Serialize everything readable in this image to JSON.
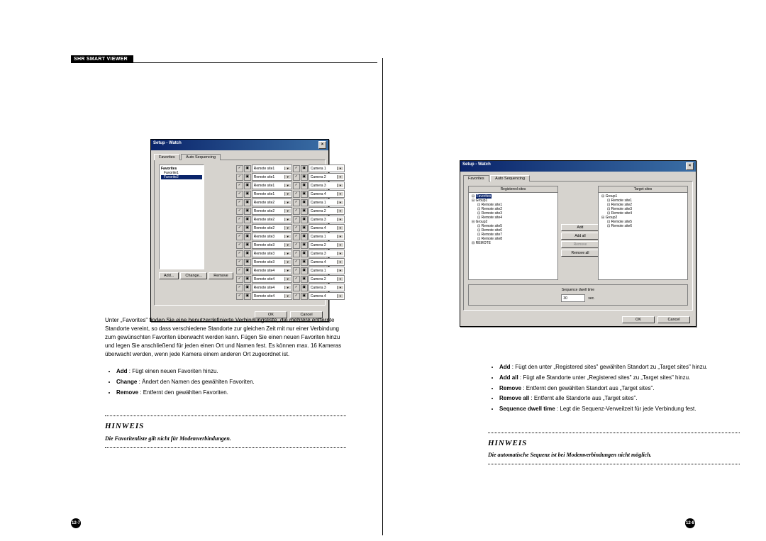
{
  "header": "SHR SMART VIEWER",
  "pageLeft": "12-7",
  "pageRight": "12-8",
  "win1": {
    "title": "Setup - Watch",
    "tab1": "Favorites",
    "tab2": "Auto Sequencing",
    "favHeader": "Favorites",
    "favItems": [
      "Favorite1",
      "Favorite2"
    ],
    "rows": [
      {
        "site": "Remote site1",
        "cam": "Camera 1"
      },
      {
        "site": "Remote site1",
        "cam": "Camera 2"
      },
      {
        "site": "Remote site1",
        "cam": "Camera 3"
      },
      {
        "site": "Remote site1",
        "cam": "Camera 4"
      },
      {
        "site": "Remote site2",
        "cam": "Camera 1"
      },
      {
        "site": "Remote site2",
        "cam": "Camera 2"
      },
      {
        "site": "Remote site2",
        "cam": "Camera 3"
      },
      {
        "site": "Remote site2",
        "cam": "Camera 4"
      },
      {
        "site": "Remote site3",
        "cam": "Camera 1"
      },
      {
        "site": "Remote site3",
        "cam": "Camera 2"
      },
      {
        "site": "Remote site3",
        "cam": "Camera 3"
      },
      {
        "site": "Remote site3",
        "cam": "Camera 4"
      },
      {
        "site": "Remote site4",
        "cam": "Camera 1"
      },
      {
        "site": "Remote site4",
        "cam": "Camera 2"
      },
      {
        "site": "Remote site4",
        "cam": "Camera 3"
      },
      {
        "site": "Remote site4",
        "cam": "Camera 4"
      }
    ],
    "btnAdd": "Add...",
    "btnChange": "Change...",
    "btnRemove": "Remove",
    "btnOK": "OK",
    "btnCancel": "Cancel"
  },
  "win2": {
    "title": "Setup - Watch",
    "tab1": "Favorites",
    "tab2": "Auto Sequencing",
    "regTitle": "Registered sites",
    "tgtTitle": "Target sites",
    "regTree": [
      {
        "lvl": 0,
        "t": "Favorites",
        "sel": true
      },
      {
        "lvl": 0,
        "t": "Group1"
      },
      {
        "lvl": 1,
        "t": "Remote site1"
      },
      {
        "lvl": 1,
        "t": "Remote site2"
      },
      {
        "lvl": 1,
        "t": "Remote site3"
      },
      {
        "lvl": 1,
        "t": "Remote site4"
      },
      {
        "lvl": 0,
        "t": "Group2"
      },
      {
        "lvl": 1,
        "t": "Remote site5"
      },
      {
        "lvl": 1,
        "t": "Remote site6"
      },
      {
        "lvl": 1,
        "t": "Remote site7"
      },
      {
        "lvl": 1,
        "t": "Remote site8"
      },
      {
        "lvl": 0,
        "t": "REMOTE"
      }
    ],
    "tgtTree": [
      {
        "lvl": 0,
        "t": "Group1"
      },
      {
        "lvl": 1,
        "t": "Remote site1"
      },
      {
        "lvl": 1,
        "t": "Remote site2"
      },
      {
        "lvl": 1,
        "t": "Remote site3"
      },
      {
        "lvl": 1,
        "t": "Remote site4"
      },
      {
        "lvl": 0,
        "t": "Group2"
      },
      {
        "lvl": 1,
        "t": "Remote site5"
      },
      {
        "lvl": 1,
        "t": "Remote site6"
      }
    ],
    "btnAdd": "Add",
    "btnAddAll": "Add all",
    "btnRemove": "Remove",
    "btnRemoveAll": "Remove all",
    "dwellLabel": "Sequence dwell time",
    "dwellVal": "30",
    "dwellUnit": "sec.",
    "btnOK": "OK",
    "btnCancel": "Cancel"
  },
  "textL": {
    "para": "Unter „Favorites\" finden Sie eine benutzerdefinierte Verbindungsliste, die mehrere entfernte Standorte vereint, so dass verschiedene Standorte zur gleichen Zeit mit nur einer Verbindung zum gewünschten Favoriten überwacht werden kann. Fügen Sie einen neuen Favoriten hinzu und legen Sie anschließend für jeden einen Ort und Namen fest. Es können max. 16 Kameras überwacht werden, wenn jede Kamera einem anderen Ort zugeordnet ist.",
    "b1b": "Add",
    "b1": " : Fügt einen neuen Favoriten hinzu.",
    "b2b": "Change",
    "b2": " : Ändert den Namen des gewählten Favoriten.",
    "b3b": "Remove",
    "b3": " : Entfernt den gewählten Favoriten.",
    "hTitle": "HINWEIS",
    "hText": "Die Favoritenliste gilt nicht für Modemverbindungen."
  },
  "textR": {
    "b1b": "Add",
    "b1": " : Fügt den unter „Registered sites\" gewählten Standort zu „Target sites\" hinzu.",
    "b2b": "Add all",
    "b2": " : Fügt alle Standorte unter „Registered sites\" zu „Target sites\" hinzu.",
    "b3b": "Remove",
    "b3": " : Entfernt den gewählten Standort aus „Target sites\".",
    "b4b": "Remove all",
    "b4": " : Entfernt alle Standorte aus „Target sites\".",
    "b5b": "Sequence dwell time",
    "b5": " : Legt die Sequenz-Verweilzeit für jede Verbindung fest.",
    "hTitle": "HINWEIS",
    "hText": "Die automatische Sequenz ist bei Modemverbindungen nicht möglich."
  }
}
